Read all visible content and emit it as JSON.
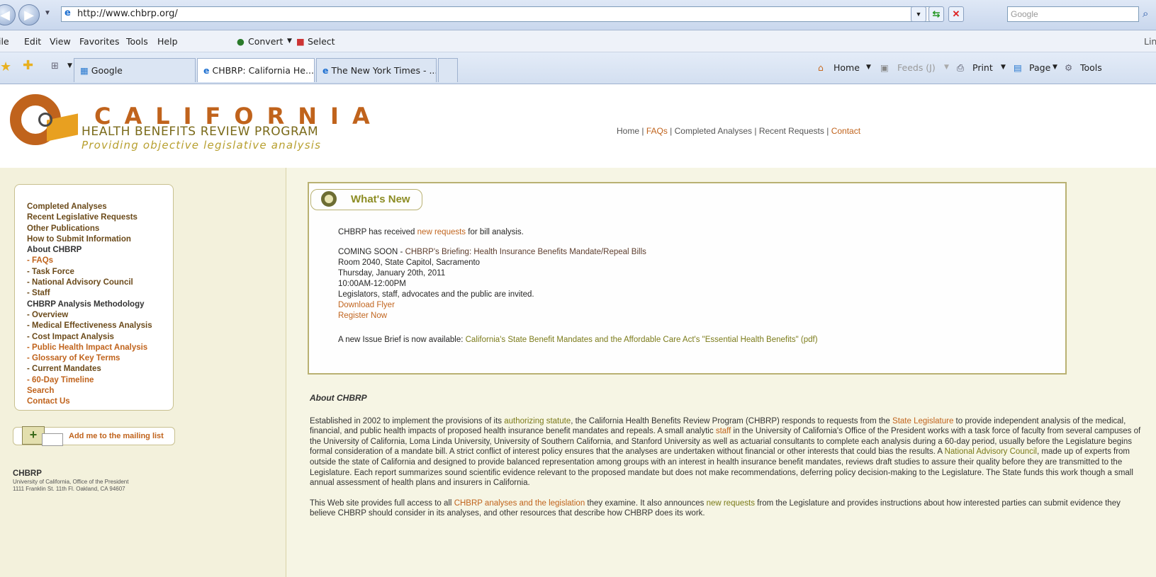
{
  "browser": {
    "url": "http://www.chbrp.org/",
    "search_placeholder": "Google",
    "menu": [
      "ile",
      "Edit",
      "View",
      "Favorites",
      "Tools",
      "Help"
    ],
    "convert_label": "Convert",
    "select_label": "Select",
    "links_label": "Lin",
    "tabs": [
      {
        "label": "Google"
      },
      {
        "label": "CHBRP: California He..."
      },
      {
        "label": "The New York Times - ..."
      }
    ],
    "commands": {
      "home": "Home",
      "feeds": "Feeds (J)",
      "print": "Print",
      "page": "Page",
      "tools": "Tools"
    }
  },
  "header": {
    "california": "CALIFORNIA",
    "program": "HEALTH BENEFITS REVIEW PROGRAM",
    "tagline": "Providing objective legislative analysis",
    "nav": {
      "home": "Home",
      "faqs": "FAQs",
      "completed": "Completed Analyses",
      "recent": "Recent Requests",
      "contact": "Contact",
      "sep": " | "
    }
  },
  "sidebar": {
    "items": [
      {
        "label": "Completed Analyses"
      },
      {
        "label": "Recent Legislative Requests"
      },
      {
        "label": "Other Publications"
      },
      {
        "label": "How to Submit Information"
      },
      {
        "label": "About CHBRP"
      },
      {
        "label": "- FAQs"
      },
      {
        "label": "- Task Force"
      },
      {
        "label": "- National Advisory Council"
      },
      {
        "label": "- Staff"
      },
      {
        "label": "CHBRP Analysis Methodology"
      },
      {
        "label": "- Overview"
      },
      {
        "label": "- Medical Effectiveness Analysis"
      },
      {
        "label": "- Cost Impact Analysis"
      },
      {
        "label": "- Public Health Impact Analysis"
      },
      {
        "label": "- Glossary of Key Terms"
      },
      {
        "label": "- Current Mandates"
      },
      {
        "label": "- 60-Day Timeline"
      },
      {
        "label": "Search"
      },
      {
        "label": "Contact Us"
      }
    ],
    "mailing_label": "Add me to the mailing list",
    "org": "CHBRP",
    "addr1": "University of California, Office of the President",
    "addr2": "1111 Franklin St. 11th Fl. Oakland, CA 94607"
  },
  "news": {
    "title": "What's New",
    "l1_pre": "CHBRP has received ",
    "l1_link": "new requests",
    "l1_post": " for bill analysis.",
    "soon_label": "COMING SOON - ",
    "soon_text": "CHBRP's Briefing: Health Insurance Benefits Mandate/Repeal Bills",
    "room": "Room 2040, State Capitol, Sacramento",
    "date": "Thursday, January 20th, 2011",
    "time": "10:00AM-12:00PM",
    "invited": "Legislators, staff, advocates and the public are invited.",
    "flyer": "Download Flyer",
    "register": "Register Now",
    "brief_pre": "A new Issue Brief is now available: ",
    "brief_link": "California's State Benefit Mandates and the Affordable Care Act's \"Essential Health Benefits\" (pdf)"
  },
  "about": {
    "heading": "About CHBRP",
    "p1_a": "Established in 2002 to implement the provisions of its ",
    "p1_link1": "authorizing statute",
    "p1_b": ", the California Health Benefits Review Program (CHBRP) responds to requests from the ",
    "p1_link2": "State Legislature",
    "p1_c": " to provide independent analysis of the medical, financial, and public health impacts of proposed health insurance benefit mandates and repeals. A small analytic ",
    "p1_link3": "staff",
    "p1_d": " in the University of California's Office of the President works with a task force of faculty from several campuses of the University of California, Loma Linda University, University of Southern California, and Stanford University as well as actuarial consultants to complete each analysis during a 60-day period, usually before the Legislature begins formal consideration of a mandate bill. A strict conflict of interest policy ensures that the analyses are undertaken without financial or other interests that could bias the results. A ",
    "p1_link4": "National Advisory Council",
    "p1_e": ", made up of experts from outside the state of California and designed to provide balanced representation among groups with an interest in health insurance benefit mandates, reviews draft studies to assure their quality before they are transmitted to the Legislature. Each report summarizes sound scientific evidence relevant to the proposed mandate but does not make recommendations, deferring policy decision-making to the Legislature. The State funds this work though a small annual assessment of health plans and insurers in California.",
    "p2_a": "This Web site provides full access to all ",
    "p2_link1": "CHBRP analyses and the legislation",
    "p2_b": " they examine. It also announces ",
    "p2_link2": "new requests",
    "p2_c": " from the Legislature and provides instructions about how interested parties can submit evidence they believe CHBRP should consider in its analyses, and other resources that describe how CHBRP does its work."
  }
}
